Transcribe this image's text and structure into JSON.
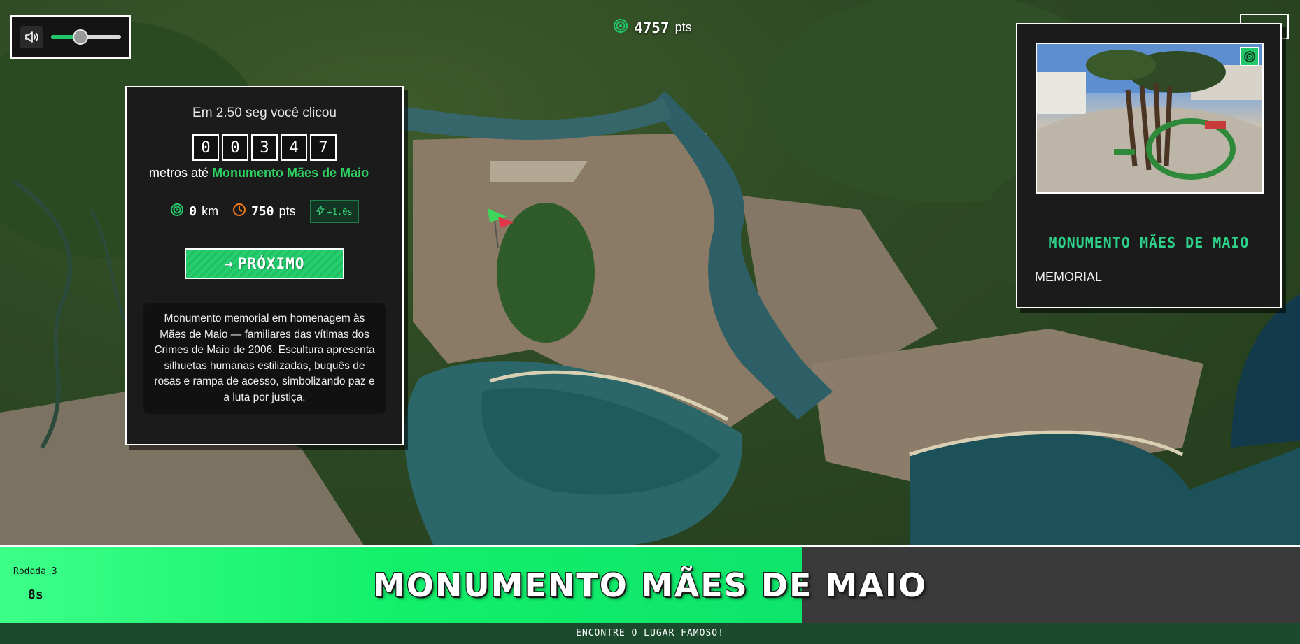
{
  "volume": {
    "level": 0.42,
    "speaker_icon": "speaker-icon"
  },
  "total_score": {
    "value": "4757",
    "unit": "pts",
    "icon": "target-icon"
  },
  "result": {
    "clicked_text": "Em 2.50 seg você clicou",
    "distance_digits": [
      "0",
      "0",
      "3",
      "4",
      "7"
    ],
    "meters_prefix": "metros até",
    "place_name": "Monumento Mães de Maio",
    "distance_km": "0",
    "distance_unit": "km",
    "time_points": "750",
    "points_unit": "pts",
    "bonus": "+1.0s",
    "next_label": "PRÓXIMO",
    "description": "Monumento memorial em homenagem às Mães de Maio — familiares das vítimas dos Crimes de Maio de 2006. Escultura apresenta silhuetas humanas estilizadas, buquês de rosas e rampa de acesso, simbolizando paz e a luta por justiça.",
    "colors": {
      "accent": "#2ed163",
      "time_icon": "#f07a1a"
    }
  },
  "card": {
    "title": "MONUMENTO MÃES DE MAIO",
    "category": "MEMORIAL",
    "photo_badge_icon": "target-icon"
  },
  "bottom": {
    "round_label": "Rodada 3",
    "time_left": "8s",
    "timer_fraction": 0.617,
    "place_title": "MONUMENTO MÃES DE MAIO",
    "footer_text": "ENCONTRE O LUGAR FAMOSO!"
  }
}
